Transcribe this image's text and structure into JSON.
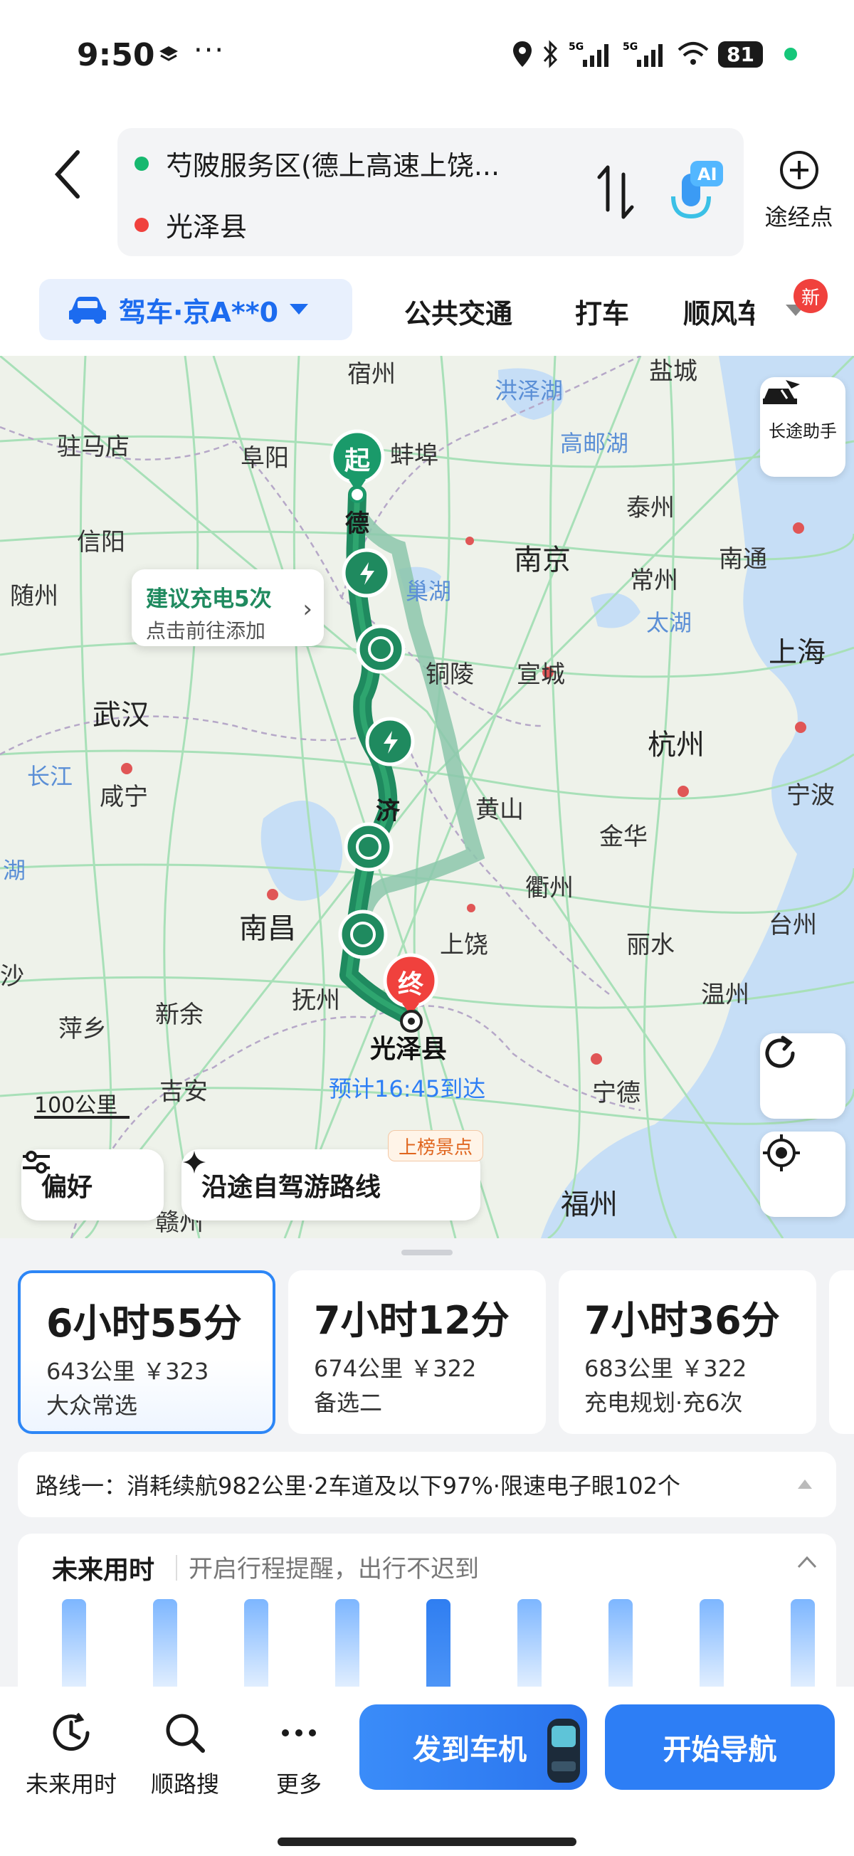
{
  "status_bar": {
    "time": "9:50",
    "more": "···",
    "battery": "81",
    "icons": [
      "layers-icon",
      "location-icon",
      "bluetooth-icon",
      "signal-5g-icon",
      "signal-5g-icon",
      "wifi-icon"
    ]
  },
  "route": {
    "origin": "芍陂服务区(德上高速上饶...",
    "destination": "光泽县",
    "via_label": "途经点",
    "ai_label": "AI"
  },
  "modes": {
    "drive": "驾车·京A**0",
    "transit": "公共交通",
    "taxi": "打车",
    "carpool": "顺风车",
    "new_badge": "新"
  },
  "map": {
    "cities": [
      {
        "name": "宿州"
      },
      {
        "name": "盐城"
      },
      {
        "name": "驻马店"
      },
      {
        "name": "阜阳"
      },
      {
        "name": "蚌埠"
      },
      {
        "name": "洪泽湖"
      },
      {
        "name": "高邮湖"
      },
      {
        "name": "泰州"
      },
      {
        "name": "信阳"
      },
      {
        "name": "南京"
      },
      {
        "name": "南通"
      },
      {
        "name": "常州"
      },
      {
        "name": "巢湖"
      },
      {
        "name": "随州"
      },
      {
        "name": "太湖"
      },
      {
        "name": "上海"
      },
      {
        "name": "铜陵"
      },
      {
        "name": "宣城"
      },
      {
        "name": "武汉"
      },
      {
        "name": "杭州"
      },
      {
        "name": "长江"
      },
      {
        "name": "咸宁"
      },
      {
        "name": "黄山"
      },
      {
        "name": "宁波"
      },
      {
        "name": "金华"
      },
      {
        "name": "衢州"
      },
      {
        "name": "湖"
      },
      {
        "name": "南昌"
      },
      {
        "name": "上饶"
      },
      {
        "name": "台州"
      },
      {
        "name": "丽水"
      },
      {
        "name": "沙"
      },
      {
        "name": "抚州"
      },
      {
        "name": "温州"
      },
      {
        "name": "萍乡"
      },
      {
        "name": "新余"
      },
      {
        "name": "吉安"
      },
      {
        "name": "宁德"
      },
      {
        "name": "福州"
      },
      {
        "name": "赣州"
      }
    ],
    "start_marker": "起",
    "end_marker": "终",
    "route_labels": [
      "德",
      "济"
    ],
    "charge_tip_title": "建议充电5次",
    "charge_tip_sub": "点击前往添加",
    "assistant_label": "长途助手",
    "destination_name": "光泽县",
    "eta": "预计16:45到达",
    "scale": "100公里",
    "prefs_label": "偏好",
    "scenic_label": "沿途自驾游路线",
    "scenic_tag": "上榜景点",
    "colors": {
      "route": "#1f8a5f",
      "alt_route": "#6fb99a",
      "accent": "#2d7ef5",
      "end": "#f0413d"
    }
  },
  "routes": [
    {
      "time": "6小时55分",
      "stats": "643公里 ￥323",
      "tag": "大众常选"
    },
    {
      "time": "7小时12分",
      "stats": "674公里 ￥322",
      "tag": "备选二"
    },
    {
      "time": "7小时36分",
      "stats": "683公里 ￥322",
      "tag": "充电规划·充6次"
    }
  ],
  "route_info": "路线一：消耗续航982公里·2车道及以下97%·限速电子眼102个",
  "future": {
    "title": "未来用时",
    "subtitle": "开启行程提醒，出行不迟到"
  },
  "actions": {
    "future_time": "未来用时",
    "along_search": "顺路搜",
    "more": "更多",
    "send_to_car": "发到车机",
    "start_nav": "开始导航"
  }
}
